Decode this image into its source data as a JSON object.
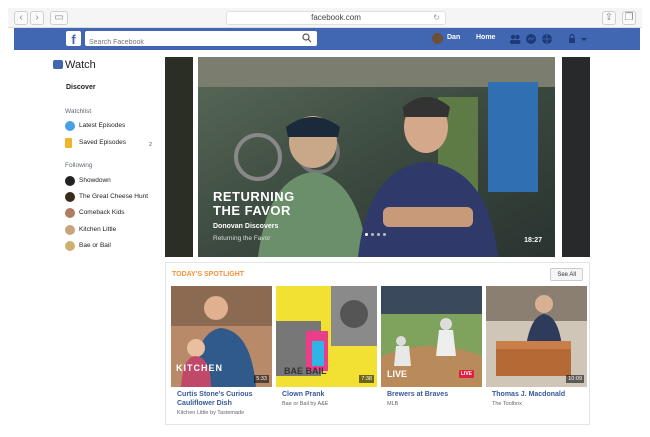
{
  "browser": {
    "url": "facebook.com"
  },
  "header": {
    "logo": "f",
    "search_placeholder": "Search Facebook",
    "username": "Dan",
    "home": "Home"
  },
  "sidebar": {
    "title": "Watch",
    "discover": "Discover",
    "watchlist_label": "Watchlist",
    "watchlist": [
      {
        "label": "Latest Episodes",
        "icon": "play-icon",
        "color": "#4aa0e6"
      },
      {
        "label": "Saved Episodes",
        "icon": "bookmark-icon",
        "color": "#f0b429",
        "count": "2"
      }
    ],
    "following_label": "Following",
    "following": [
      {
        "label": "Showdown",
        "color": "#222"
      },
      {
        "label": "The Great Cheese Hunt",
        "color": "#3a2a1a"
      },
      {
        "label": "Comeback Kids",
        "color": "#b07c62"
      },
      {
        "label": "Kitchen Little",
        "color": "#c9a27e"
      },
      {
        "label": "Bae or Bail",
        "color": "#d0b070"
      }
    ]
  },
  "hero": {
    "title_line1": "RETURNING",
    "title_line2": "THE FAVOR",
    "host": "Donovan Discovers",
    "show": "Returning the Favor",
    "duration": "18:27"
  },
  "spotlight": {
    "title": "TODAY'S SPOTLIGHT",
    "see_all": "See All",
    "cards": [
      {
        "title": "Curtis Stone's Curious Cauliflower Dish",
        "subtitle": "Kitchen Little by Tastemade",
        "duration": "5:33",
        "brand": "KITCHEN"
      },
      {
        "title": "Clown Prank",
        "subtitle": "Bae or Bail by A&E",
        "duration": "7:38",
        "brand": "BAE BAIL"
      },
      {
        "title": "Brewers at Braves",
        "subtitle": "MLB",
        "badge": "LIVE",
        "brand": "LIVE"
      },
      {
        "title": "Thomas J. Macdonald",
        "subtitle": "The Toolbox",
        "duration": "10:09"
      }
    ]
  }
}
